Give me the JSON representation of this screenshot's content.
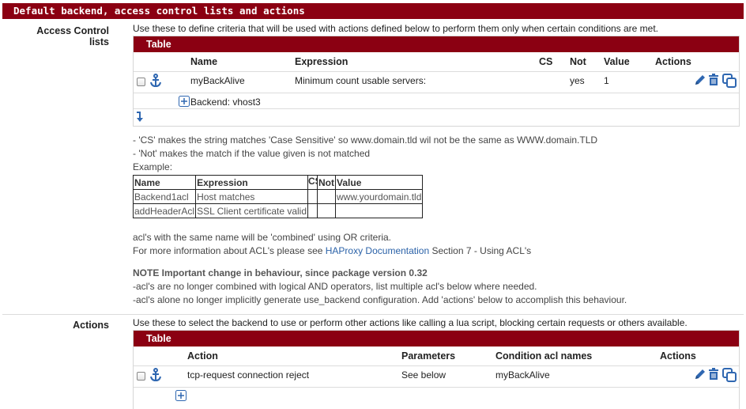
{
  "section": {
    "title": "Default backend, access control lists and actions"
  },
  "acl": {
    "label": "Access Control lists",
    "description": "Use these to define criteria that will be used with actions defined below to perform them only when certain conditions are met.",
    "table_title": "Table",
    "headers": [
      "Name",
      "Expression",
      "CS",
      "Not",
      "Value",
      "Actions"
    ],
    "rows": [
      {
        "name": "myBackAlive",
        "expression": "Minimum count usable servers:",
        "cs": "",
        "not": "yes",
        "value": "1"
      }
    ],
    "sub_row": "Backend: vhost3"
  },
  "notes": {
    "line1": "- 'CS' makes the string matches 'Case Sensitive' so www.domain.tld wil not be the same as WWW.domain.TLD",
    "line2": "- 'Not' makes the match if the value given is not matched",
    "line3": "Example:",
    "example_headers": [
      "Name",
      "Expression",
      "CS",
      "Not",
      "Value"
    ],
    "example_rows": [
      [
        "Backend1acl",
        "Host matches",
        "",
        "",
        "www.yourdomain.tld"
      ],
      [
        "addHeaderAcl",
        "SSL Client certificate valid",
        "",
        "",
        ""
      ]
    ],
    "combined": "acl's with the same name will be 'combined' using OR criteria.",
    "more_info_prefix": "For more information about ACL's please see ",
    "more_info_link": "HAProxy Documentation",
    "more_info_suffix": " Section 7 - Using ACL's",
    "note_title": "NOTE Important change in behaviour, since package version 0.32",
    "note_1": "-acl's are no longer combined with logical AND operators, list multiple acl's below where needed.",
    "note_2": "-acl's alone no longer implicitly generate use_backend configuration. Add 'actions' below to accomplish this behaviour."
  },
  "actions": {
    "label": "Actions",
    "description": "Use these to select the backend to use or perform other actions like calling a lua script, blocking certain requests or others available.",
    "table_title": "Table",
    "headers": [
      "Action",
      "Parameters",
      "Condition acl names",
      "Actions"
    ],
    "rows": [
      {
        "action": "tcp-request connection reject",
        "parameters": "See below",
        "condition": "myBackAlive"
      }
    ]
  },
  "icons": {
    "anchor": "anchor-icon",
    "edit": "pencil-icon",
    "delete": "trash-icon",
    "copy": "copy-icon",
    "expand": "plus-box-icon",
    "move": "arrow-down-return-icon"
  },
  "colors": {
    "accent": "#8b0012",
    "icon_blue": "#2f67b1",
    "link": "#2b62a8"
  }
}
